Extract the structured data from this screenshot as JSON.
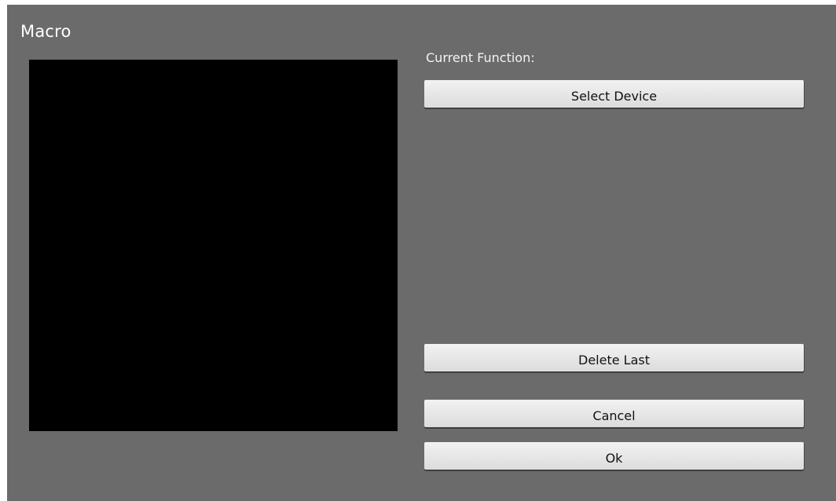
{
  "dialog": {
    "title": "Macro",
    "current_function_label": "Current Function:"
  },
  "buttons": {
    "select_device": "Select Device",
    "delete_last": "Delete Last",
    "cancel": "Cancel",
    "ok": "Ok"
  },
  "colors": {
    "dialog_background": "#6b6b6b",
    "preview_background": "#000000",
    "button_background": "#e6e6e6",
    "title_text": "#ffffff"
  }
}
